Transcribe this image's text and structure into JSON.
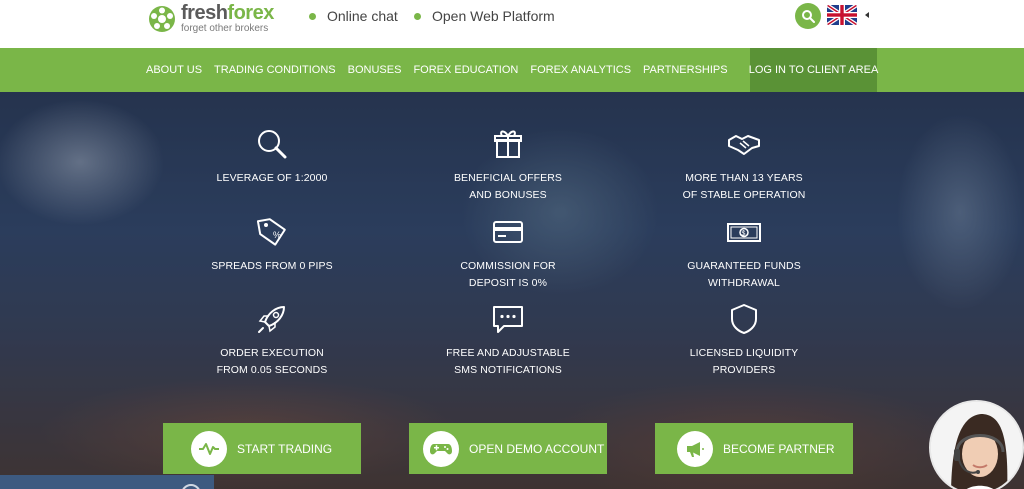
{
  "header": {
    "logo": {
      "name_dark": "fresh",
      "name_accent": "forex",
      "tagline": "forget other brokers"
    },
    "links": [
      {
        "label": "Online chat"
      },
      {
        "label": "Open Web Platform"
      }
    ],
    "search_icon": "search-icon",
    "language_flag": "uk-flag-icon"
  },
  "nav": {
    "items": [
      {
        "label": "ABOUT US"
      },
      {
        "label": "TRADING CONDITIONS"
      },
      {
        "label": "BONUSES"
      },
      {
        "label": "FOREX EDUCATION"
      },
      {
        "label": "FOREX ANALYTICS"
      },
      {
        "label": "PARTNERSHIPS"
      }
    ],
    "login_label": "LOG IN TO CLIENT AREA"
  },
  "features": [
    {
      "icon": "magnifier-icon",
      "line1": "LEVERAGE OF 1:2000",
      "line2": ""
    },
    {
      "icon": "gift-icon",
      "line1": "BENEFICIAL OFFERS",
      "line2": "AND BONUSES"
    },
    {
      "icon": "handshake-icon",
      "line1": "MORE THAN 13 YEARS",
      "line2": "OF STABLE OPERATION"
    },
    {
      "icon": "price-tag-icon",
      "line1": "SPREADS FROM 0 PIPS",
      "line2": ""
    },
    {
      "icon": "credit-card-icon",
      "line1": "COMMISSION FOR",
      "line2": "DEPOSIT IS 0%"
    },
    {
      "icon": "money-icon",
      "line1": "GUARANTEED FUNDS",
      "line2": "WITHDRAWAL"
    },
    {
      "icon": "rocket-icon",
      "line1": "ORDER EXECUTION",
      "line2": "FROM 0.05 SECONDS"
    },
    {
      "icon": "chat-bubble-icon",
      "line1": "FREE AND ADJUSTABLE",
      "line2": "SMS NOTIFICATIONS"
    },
    {
      "icon": "shield-icon",
      "line1": "LICENSED LIQUIDITY",
      "line2": "PROVIDERS"
    }
  ],
  "cta": {
    "start": "START TRADING",
    "demo": "OPEN DEMO ACCOUNT",
    "partner": "BECOME PARTNER"
  },
  "colors": {
    "brand_green": "#7ab648",
    "login_green": "#5a9236"
  }
}
